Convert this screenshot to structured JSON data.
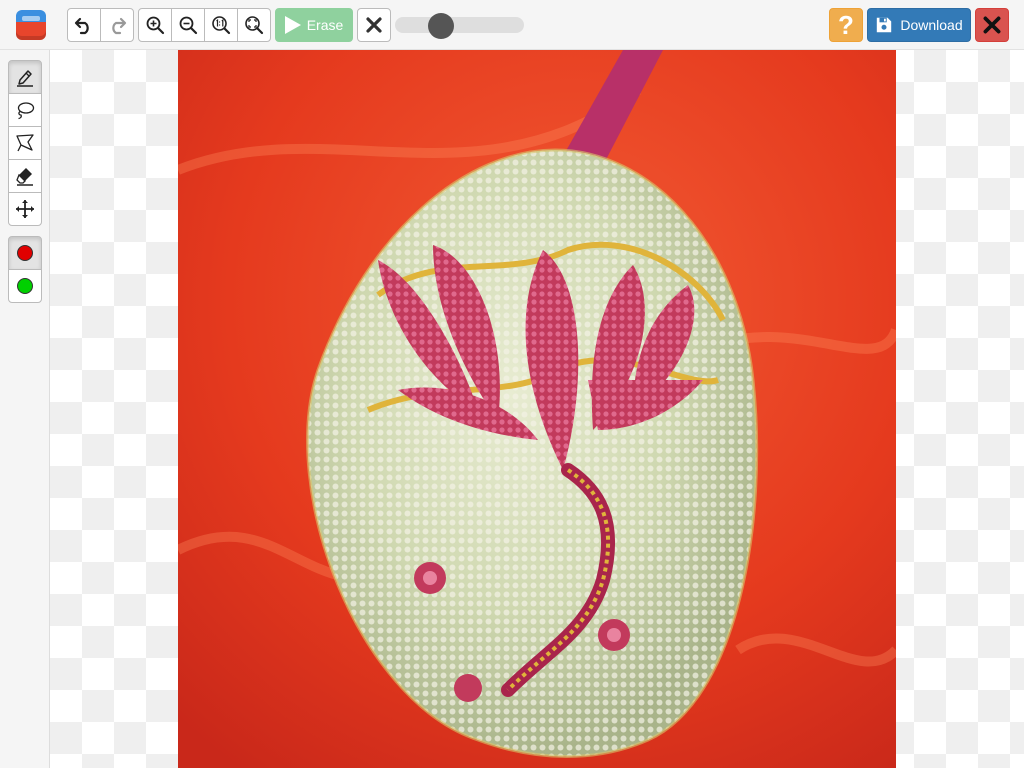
{
  "app": {
    "logo_icon": "app-logo-icon"
  },
  "toolbar": {
    "history": [
      {
        "name": "undo-icon"
      },
      {
        "name": "redo-icon"
      }
    ],
    "zoom": [
      {
        "name": "zoom-in-icon"
      },
      {
        "name": "zoom-out-icon"
      },
      {
        "name": "zoom-actual-size-icon"
      },
      {
        "name": "zoom-fit-icon"
      }
    ],
    "erase_label": "Erase",
    "erase_icon": "play-icon",
    "clear_icon": "close-icon",
    "brush_size_fraction": 0.32,
    "help_icon": "question-icon",
    "download_label": "Download",
    "download_icon": "save-icon",
    "exit_icon": "close-icon"
  },
  "sidebar": {
    "tools": [
      {
        "name": "marker-tool",
        "icon": "marker-icon",
        "active": true
      },
      {
        "name": "lasso-tool",
        "icon": "lasso-icon",
        "active": false
      },
      {
        "name": "polygon-lasso-tool",
        "icon": "polygon-icon",
        "active": false
      },
      {
        "name": "eraser-tool",
        "icon": "eraser-icon",
        "active": false
      },
      {
        "name": "move-tool",
        "icon": "move-icon",
        "active": false
      }
    ],
    "colors": [
      {
        "name": "remove-color",
        "color": "#e00000",
        "active": true
      },
      {
        "name": "keep-color",
        "color": "#00d000",
        "active": false
      }
    ]
  },
  "colors": {
    "download": "#337ab7",
    "help": "#f0ad4e",
    "exit": "#d9534f",
    "erase": "#8fd19e"
  },
  "canvas": {
    "image_subject": "beaded-ornament-photo"
  }
}
